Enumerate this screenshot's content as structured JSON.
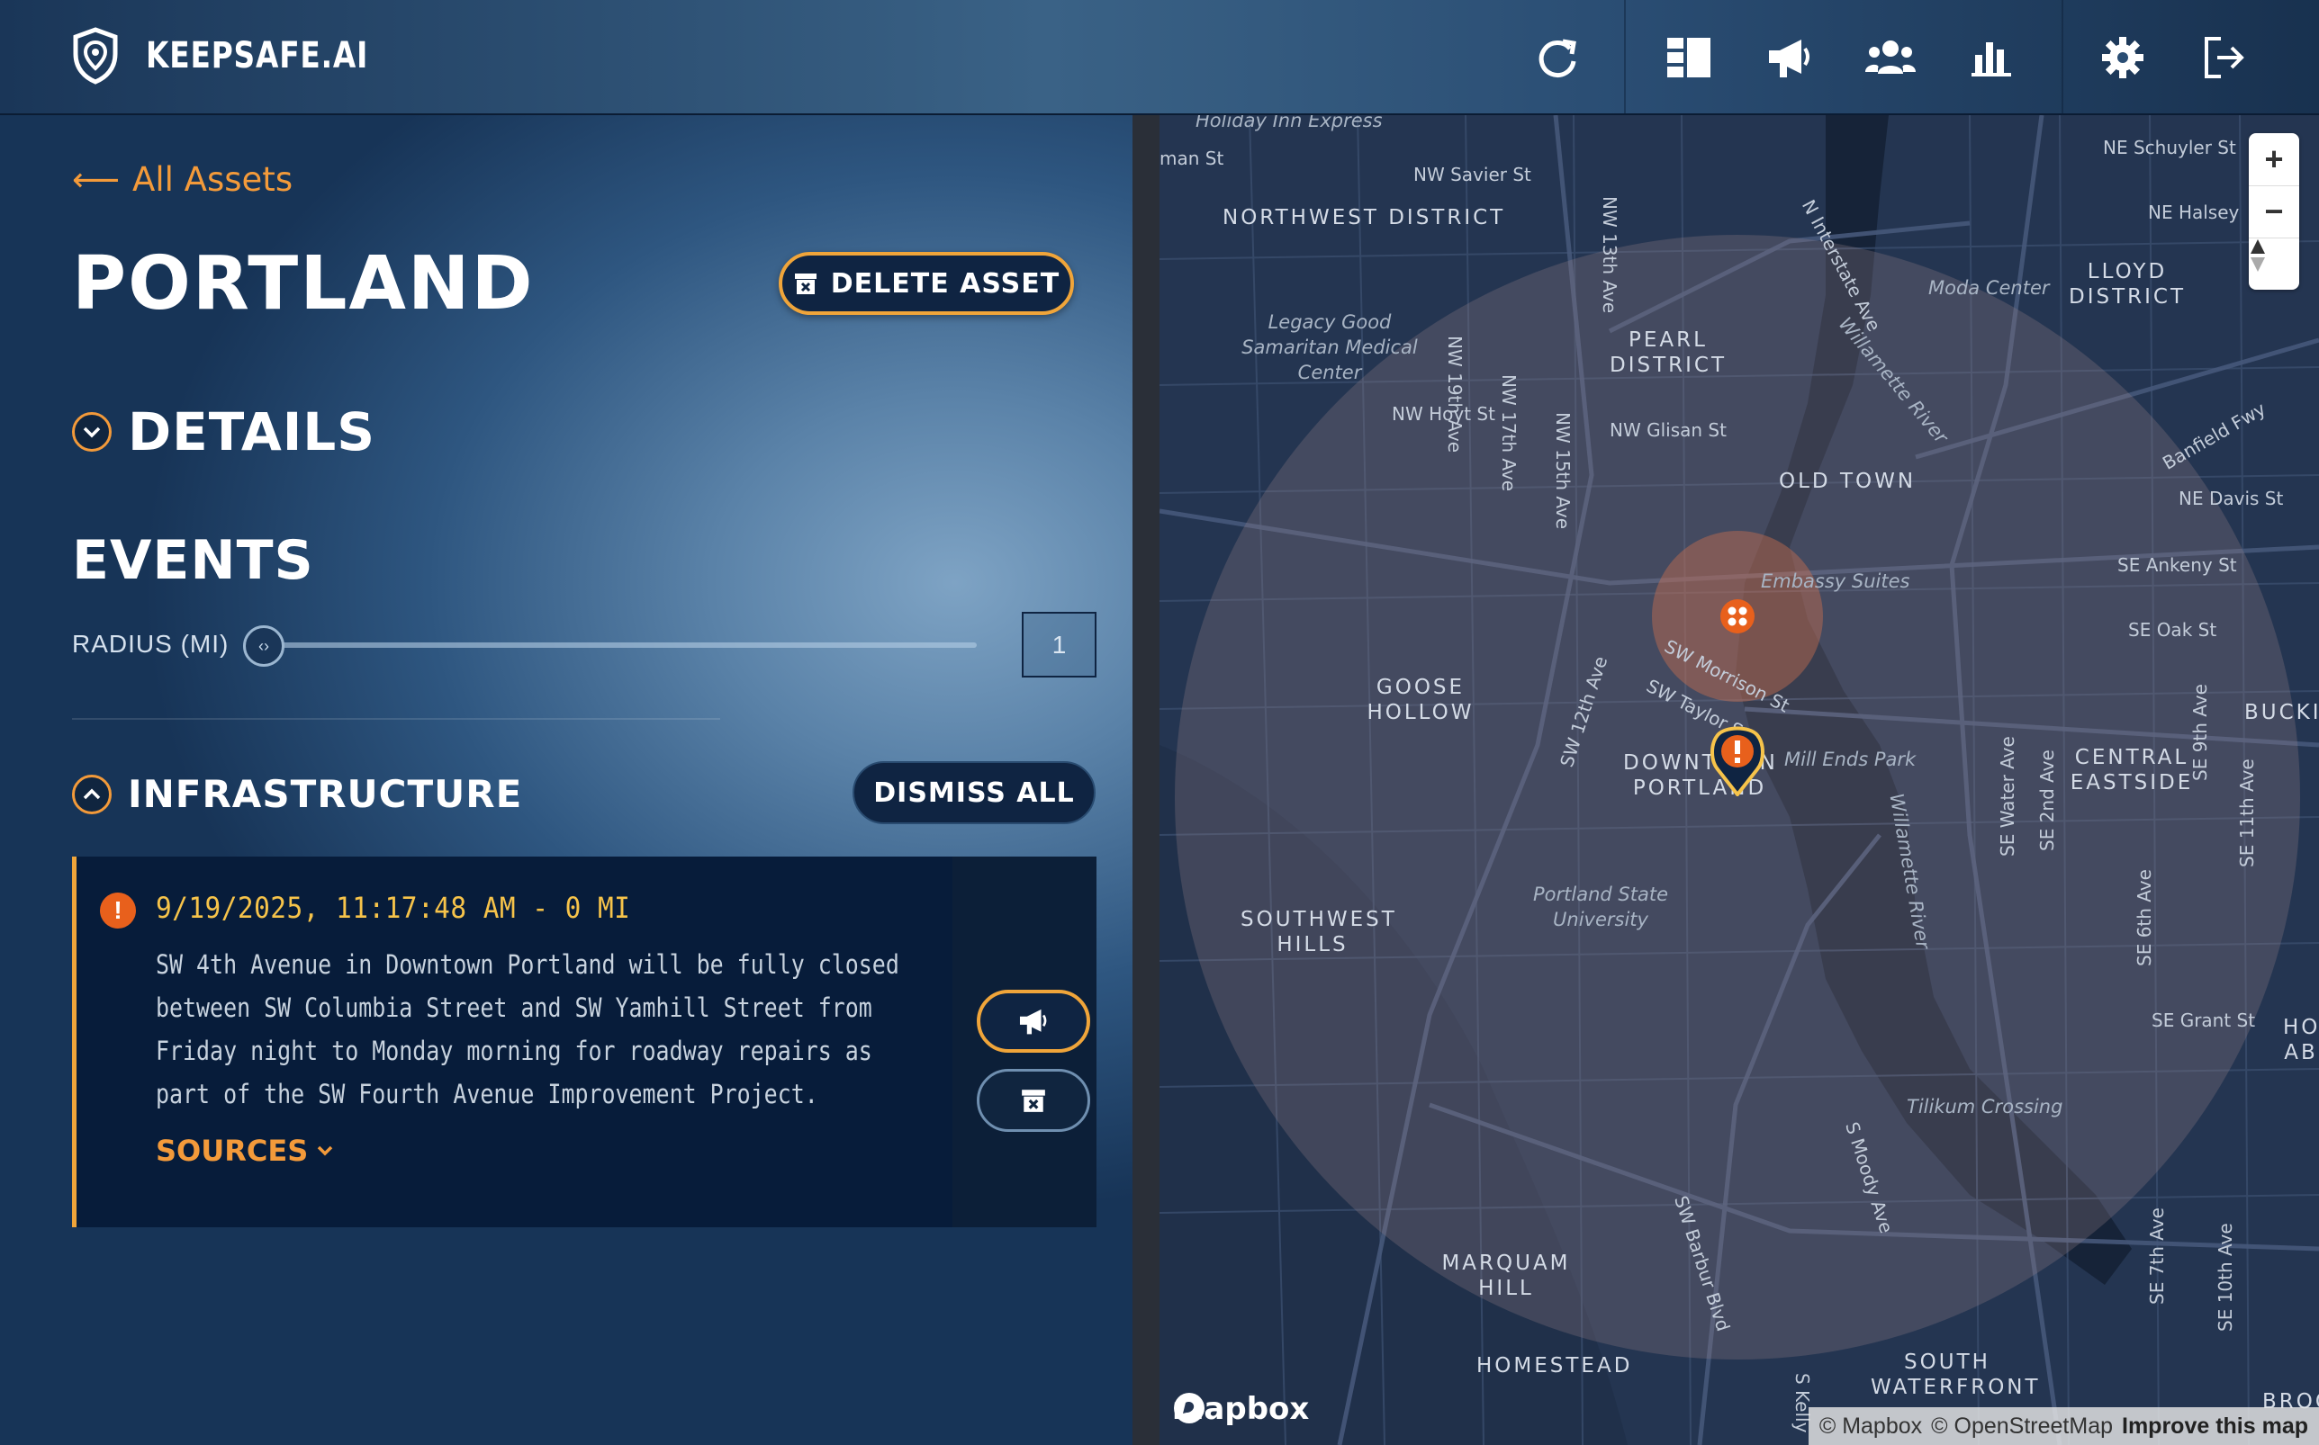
{
  "header": {
    "brand": "KEEPSAFE.AI",
    "nav_icons": [
      "refresh-icon",
      "dashboard-icon",
      "megaphone-icon",
      "users-icon",
      "bar-chart-icon",
      "gear-icon",
      "logout-icon"
    ]
  },
  "asset": {
    "back_link": "All Assets",
    "title": "PORTLAND",
    "delete_button": "DELETE ASSET"
  },
  "details": {
    "label": "DETAILS"
  },
  "events": {
    "title": "EVENTS",
    "radius_label": "RADIUS (MI)",
    "radius_value": "1",
    "radius_fraction": 0.0
  },
  "infrastructure": {
    "label": "INFRASTRUCTURE",
    "dismiss_all": "DISMISS ALL",
    "items": [
      {
        "timestamp": "9/19/2025, 11:17:48 AM - 0 MI",
        "description": "SW 4th Avenue in Downtown Portland will be fully closed between SW Columbia Street and SW Yamhill Street from Friday night to Monday morning for roadway repairs as part of the SW Fourth Avenue Improvement Project.",
        "sources_label": "SOURCES"
      }
    ]
  },
  "map": {
    "districts": [
      "NORTHWEST DISTRICT",
      "PEARL DISTRICT",
      "LLOYD DISTRICT",
      "OLD TOWN",
      "GOOSE HOLLOW",
      "DOWNTOWN PORTLAND",
      "CENTRAL EASTSIDE",
      "SOUTHWEST HILLS",
      "MARQUAM HILL",
      "HOMESTEAD",
      "SOUTH WATERFRONT",
      "BUCKI",
      "HO AB",
      "BROO"
    ],
    "streets": [
      "man St",
      "NW Savier St",
      "NE Schuyler St",
      "NE Halsey",
      "NW 19th Ave",
      "NW 17th Ave",
      "NW 13th Ave",
      "NW 15th Ave",
      "N Interstate Ave",
      "NW Hoyt St",
      "NW Glisan St",
      "Banfield Fwy",
      "NE Davis St",
      "SE Ankeny St",
      "SE Oak St",
      "SW Morrison St",
      "SW Taylor St",
      "SW 12th Ave",
      "SE Water Ave",
      "SE 2nd Ave",
      "SE 9th Ave",
      "SE 11th Ave",
      "SE 6th Ave",
      "SE Grant St",
      "S Moody Ave",
      "SW Barbur Blvd",
      "SE 7th Ave",
      "SE 10th Ave",
      "S Kelly",
      "Willamette River",
      "Willamette River"
    ],
    "pois": [
      "Holiday Inn Express",
      "Moda Center",
      "Legacy Good Samaritan Medical Center",
      "Embassy Suites",
      "Mill Ends Park",
      "Portland State University",
      "Tilikum Crossing"
    ],
    "attribution": [
      "© Mapbox",
      "© OpenStreetMap",
      "Improve this map"
    ],
    "logo": "mapbox",
    "accent_color": "#f39a3a",
    "alert_color": "#e8601c"
  }
}
